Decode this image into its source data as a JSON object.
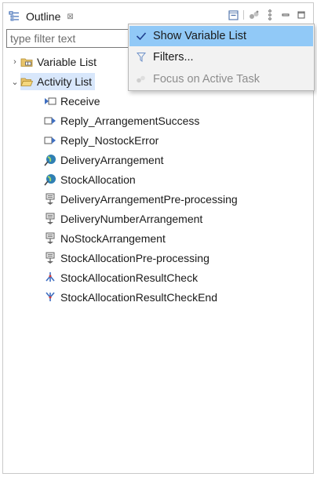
{
  "view": {
    "title": "Outline",
    "close_glyph": "⊠",
    "icon": "outline-view-icon"
  },
  "toolbar": {
    "buttons": [
      "collapse-all-icon",
      "focus-task-icon",
      "view-menu-icon",
      "minimize-icon",
      "maximize-icon"
    ]
  },
  "filter": {
    "placeholder": "type filter text",
    "value": ""
  },
  "tree": {
    "variable_list": {
      "label": "Variable List",
      "expanded": false,
      "icon": "folder-variable-icon"
    },
    "activity_list": {
      "label": "Activity List",
      "expanded": true,
      "selected": true,
      "icon": "folder-open-icon"
    },
    "activities": [
      {
        "label": "Receive",
        "icon": "receive-icon"
      },
      {
        "label": "Reply_ArrangementSuccess",
        "icon": "reply-icon"
      },
      {
        "label": "Reply_NostockError",
        "icon": "reply-icon"
      },
      {
        "label": "DeliveryArrangement",
        "icon": "invoke-icon"
      },
      {
        "label": "StockAllocation",
        "icon": "invoke-icon"
      },
      {
        "label": "DeliveryArrangementPre-processing",
        "icon": "assign-icon"
      },
      {
        "label": "DeliveryNumberArrangement",
        "icon": "assign-icon"
      },
      {
        "label": "NoStockArrangement",
        "icon": "assign-icon"
      },
      {
        "label": "StockAllocationPre-processing",
        "icon": "assign-icon"
      },
      {
        "label": "StockAllocationResultCheck",
        "icon": "branch-icon"
      },
      {
        "label": "StockAllocationResultCheckEnd",
        "icon": "merge-icon"
      }
    ]
  },
  "menu": {
    "items": [
      {
        "label": "Show Variable List",
        "checked": true,
        "highlighted": true,
        "enabled": true
      },
      {
        "label": "Filters...",
        "icon": "filter-icon",
        "enabled": true
      },
      {
        "label": "Focus on Active Task",
        "icon": "focus-task-icon",
        "enabled": false
      }
    ]
  },
  "colors": {
    "selection": "#d8e7fb",
    "menu_highlight": "#91c9f7",
    "menu_bg": "#f2f2f2"
  }
}
